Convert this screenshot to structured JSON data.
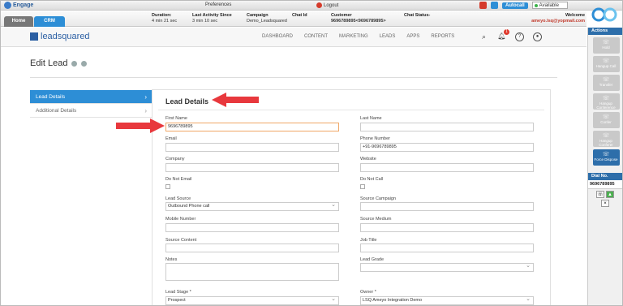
{
  "topbar": {
    "brand_small": "AMEYO",
    "brand": "Engage",
    "preferences": "Preferences",
    "logout": "Logout",
    "autocall": "Autocall",
    "status": "Available"
  },
  "tabs": {
    "home": "Home",
    "crm": "CRM"
  },
  "call_info": {
    "duration_label": "Duration:",
    "duration_value": "4 min 21 sec",
    "last_activity_label": "Last Activity Since",
    "last_activity_value": "3 min 10 sec",
    "campaign_label": "Campaign",
    "campaign_value": "Demo_Leadsquared",
    "chat_id_label": "Chat Id",
    "customer_label": "Customer",
    "customer_value": "9696789895<9696789895>",
    "chat_status_label": "Chat Status-",
    "welcome_label": "Welcome",
    "welcome_user": "ameyo.lsq@yopmail.com"
  },
  "nav": {
    "logo": "leadsquared",
    "items": [
      "DASHBOARD",
      "CONTENT",
      "MARKETING",
      "LEADS",
      "APPS",
      "REPORTS"
    ],
    "notification_count": "1"
  },
  "page": {
    "title": "Edit Lead"
  },
  "sidebar": {
    "items": [
      "Lead Details",
      "Additional Details"
    ]
  },
  "form": {
    "title": "Lead Details",
    "first_name_label": "First Name",
    "first_name_value": "9696789895",
    "last_name_label": "Last Name",
    "email_label": "Email",
    "phone_label": "Phone Number",
    "phone_value": "+91-9696789895",
    "company_label": "Company",
    "website_label": "Website",
    "do_not_email_label": "Do Not Email",
    "do_not_call_label": "Do Not Call",
    "lead_source_label": "Lead Source",
    "lead_source_value": "Outbound Phone call",
    "source_campaign_label": "Source Campaign",
    "mobile_label": "Mobile Number",
    "source_medium_label": "Source Medium",
    "source_content_label": "Source Content",
    "job_title_label": "Job Title",
    "notes_label": "Notes",
    "lead_grade_label": "Lead Grade",
    "lead_stage_label": "Lead Stage *",
    "lead_stage_value": "Prospect",
    "owner_label": "Owner *",
    "owner_value": "LSQ Ameyo Integration Demo"
  },
  "actions": {
    "header": "Actions",
    "buttons": [
      "Hold",
      "Hangup Call",
      "Transfer",
      "Hangup Conference",
      "Confer",
      "Hangup Conferer",
      "Force Dispose"
    ],
    "dial_header": "Dial No.",
    "dial_number": "9696789895"
  },
  "colors": {
    "accent": "#2d8ed6",
    "arrow": "#e8383d",
    "brand": "#2b5fa3"
  }
}
